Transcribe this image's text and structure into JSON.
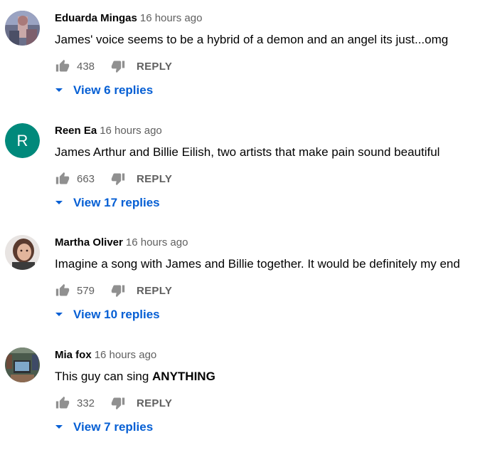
{
  "comments": [
    {
      "author": "Eduarda Mingas",
      "time": "16 hours ago",
      "text": "James' voice seems to be a hybrid of a demon and an angel its just...omg",
      "likes": "438",
      "reply_label": "REPLY",
      "view_replies": "View 6 replies",
      "avatar": {
        "type": "photo",
        "icon": "profile-photo"
      }
    },
    {
      "author": "Reen Ea",
      "time": "16 hours ago",
      "text": "James Arthur and Billie Eilish, two artists that make pain sound beautiful",
      "likes": "663",
      "reply_label": "REPLY",
      "view_replies": "View 17 replies",
      "avatar": {
        "type": "letter",
        "letter": "R",
        "color": "#00897b"
      }
    },
    {
      "author": "Martha Oliver",
      "time": "16 hours ago",
      "text": "Imagine a song with James and Billie together. It would be definitely my end",
      "likes": "579",
      "reply_label": "REPLY",
      "view_replies": "View 10 replies",
      "avatar": {
        "type": "photo",
        "icon": "profile-photo"
      }
    },
    {
      "author": "Mia fox",
      "time": "16 hours ago",
      "text_plain": "This guy can sing ",
      "text_bold": "ANYTHING",
      "likes": "332",
      "reply_label": "REPLY",
      "view_replies": "View 7 replies",
      "avatar": {
        "type": "photo",
        "icon": "profile-photo"
      }
    }
  ],
  "colors": {
    "link": "#065fd4",
    "secondary_text": "#606060",
    "primary_text": "#030303",
    "icon": "#909090"
  },
  "icons": {
    "like": "thumb-up-icon",
    "dislike": "thumb-down-icon",
    "expand": "caret-down-icon"
  }
}
